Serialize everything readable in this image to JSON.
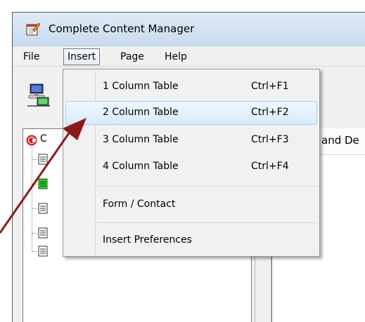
{
  "window": {
    "title": "Complete Content Manager",
    "icon": "notepad-pen-icon"
  },
  "menubar": {
    "items": [
      {
        "label": "File"
      },
      {
        "label": "Insert",
        "active": true
      },
      {
        "label": "Page"
      },
      {
        "label": "Help"
      }
    ]
  },
  "tree": {
    "root_label": "C",
    "root_icon": "red-c-logo-icon",
    "nodes": [
      {
        "icon": "document-icon",
        "highlighted": false
      },
      {
        "icon": "document-green-icon",
        "highlighted": true
      },
      {
        "icon": "document-icon",
        "highlighted": false
      },
      {
        "icon": "document-icon",
        "highlighted": false
      },
      {
        "icon": "document-icon",
        "highlighted": false
      }
    ]
  },
  "right_panel": {
    "header_text": "and De"
  },
  "insert_menu": {
    "items": [
      {
        "label": "1 Column Table",
        "shortcut": "Ctrl+F1"
      },
      {
        "label": "2 Column Table",
        "shortcut": "Ctrl+F2",
        "hover": true
      },
      {
        "label": "3 Column Table",
        "shortcut": "Ctrl+F3"
      },
      {
        "label": "4 Column Table",
        "shortcut": "Ctrl+F4"
      },
      {
        "label": "Form / Contact",
        "shortcut": ""
      },
      {
        "label": "Insert Preferences",
        "shortcut": ""
      }
    ]
  },
  "colors": {
    "arrow": "#8b1a1a",
    "menu_hover_border": "#a8d0ee",
    "titlebar": "#dfeaf6"
  }
}
